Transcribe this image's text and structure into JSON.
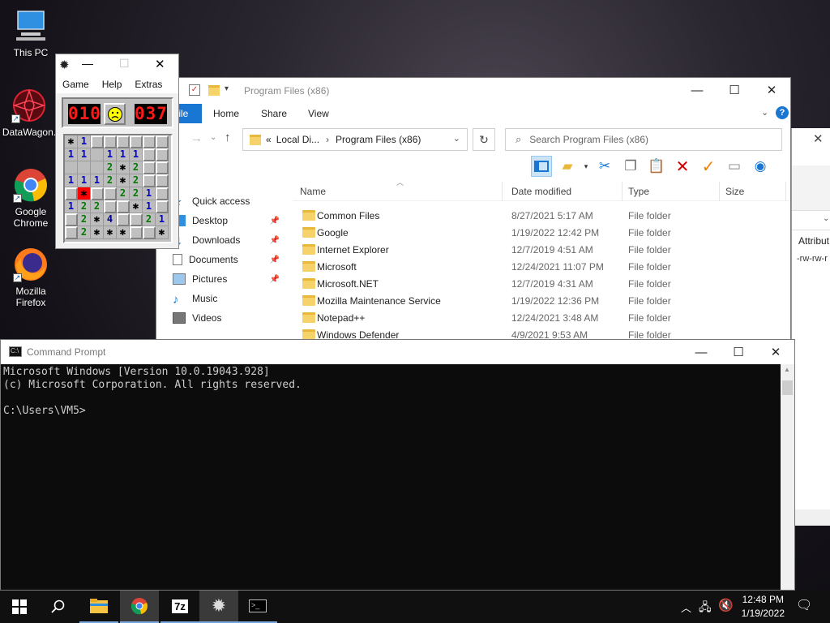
{
  "desktop": {
    "icons": [
      {
        "label": "This PC"
      },
      {
        "label": "DataWagon."
      },
      {
        "label": "Google Chrome"
      },
      {
        "label": "Mozilla Firefox"
      }
    ]
  },
  "minesweeper": {
    "menu": [
      "Game",
      "Help",
      "Extras"
    ],
    "mines_left": "010",
    "timer": "037",
    "grid": [
      [
        "*",
        "1",
        "h",
        "h",
        "h",
        "h",
        "h",
        "h"
      ],
      [
        "1",
        "1",
        "",
        "1",
        "1",
        "1",
        "h",
        "h"
      ],
      [
        "",
        "",
        "",
        "2",
        "*",
        "2",
        "h",
        "h"
      ],
      [
        "1",
        "1",
        "1",
        "2",
        "*",
        "2",
        "h",
        "h"
      ],
      [
        "h",
        "X",
        "h",
        "h",
        "2",
        "2",
        "1",
        "h"
      ],
      [
        "1",
        "2",
        "2",
        "h",
        "h",
        "*",
        "1",
        "h"
      ],
      [
        "h",
        "2",
        "*",
        "4",
        "h",
        "h",
        "2",
        "1"
      ],
      [
        "h",
        "2",
        "*",
        "*",
        "*",
        "h",
        "h",
        "*"
      ]
    ]
  },
  "explorer": {
    "title": "Program Files (x86)",
    "tabs": {
      "file": "File",
      "home": "Home",
      "share": "Share",
      "view": "View"
    },
    "address": {
      "prefix": "«",
      "part1": "Local Di...",
      "sep": "›",
      "part2": "Program Files (x86)"
    },
    "search": {
      "placeholder": "Search Program Files (x86)"
    },
    "nav": [
      "Quick access",
      "Desktop",
      "Downloads",
      "Documents",
      "Pictures",
      "Music",
      "Videos"
    ],
    "columns": {
      "name": "Name",
      "date": "Date modified",
      "type": "Type",
      "size": "Size"
    },
    "files": [
      {
        "name": "Common Files",
        "date": "8/27/2021 5:17 AM",
        "type": "File folder"
      },
      {
        "name": "Google",
        "date": "1/19/2022 12:42 PM",
        "type": "File folder"
      },
      {
        "name": "Internet Explorer",
        "date": "12/7/2019 4:51 AM",
        "type": "File folder"
      },
      {
        "name": "Microsoft",
        "date": "12/24/2021 11:07 PM",
        "type": "File folder"
      },
      {
        "name": "Microsoft.NET",
        "date": "12/7/2019 4:31 AM",
        "type": "File folder"
      },
      {
        "name": "Mozilla Maintenance Service",
        "date": "1/19/2022 12:36 PM",
        "type": "File folder"
      },
      {
        "name": "Notepad++",
        "date": "12/24/2021 3:48 AM",
        "type": "File folder"
      },
      {
        "name": "Windows Defender",
        "date": "4/9/2021 9:53 AM",
        "type": "File folder"
      }
    ]
  },
  "behind_window": {
    "attrib": "Attribut",
    "perm": "-rw-rw-r"
  },
  "cmd": {
    "title": "Command Prompt",
    "lines": "Microsoft Windows [Version 10.0.19043.928]\n(c) Microsoft Corporation. All rights reserved.\n\nC:\\Users\\VM5>"
  },
  "taskbar": {
    "time": "12:48 PM",
    "date": "1/19/2022",
    "sevenzip": "7z"
  },
  "colors": {
    "accent": "#1976d2",
    "lcd": "#ff1a1a"
  }
}
